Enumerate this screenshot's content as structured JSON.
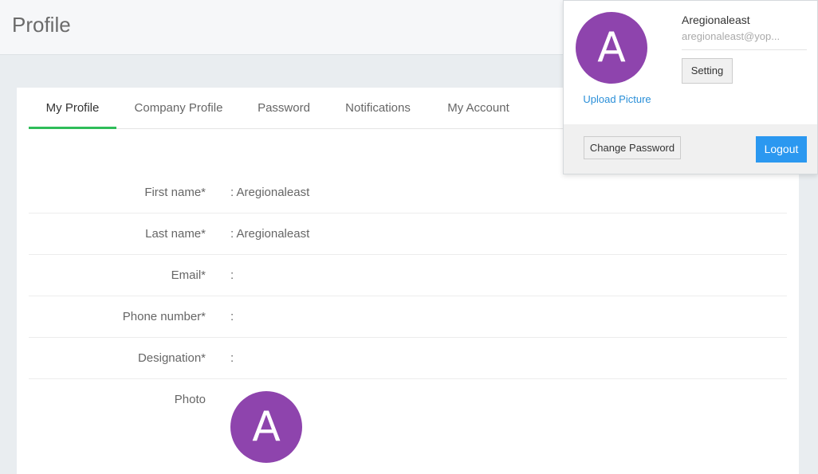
{
  "header": {
    "title": "Profile"
  },
  "tabs": [
    {
      "label": "My Profile",
      "active": true
    },
    {
      "label": "Company Profile",
      "active": false
    },
    {
      "label": "Password",
      "active": false
    },
    {
      "label": "Notifications",
      "active": false
    },
    {
      "label": "My Account",
      "active": false
    }
  ],
  "profile": {
    "fields": [
      {
        "label": "First name*",
        "value": ": Aregionaleast"
      },
      {
        "label": "Last name*",
        "value": ": Aregionaleast"
      },
      {
        "label": "Email*",
        "value": ":"
      },
      {
        "label": "Phone number*",
        "value": ":"
      },
      {
        "label": "Designation*",
        "value": ":"
      }
    ],
    "photo_label": "Photo",
    "avatar_initial": "A"
  },
  "user_menu": {
    "avatar_initial": "A",
    "upload_label": "Upload Picture",
    "name": "Aregionaleast",
    "email": "aregionaleast@yop...",
    "setting_label": "Setting",
    "change_password_label": "Change Password",
    "logout_label": "Logout"
  },
  "colors": {
    "avatar_bg": "#8e44ad",
    "active_tab": "#2ebd59",
    "link": "#2a8fd8",
    "logout_bg": "#2b98f0"
  }
}
